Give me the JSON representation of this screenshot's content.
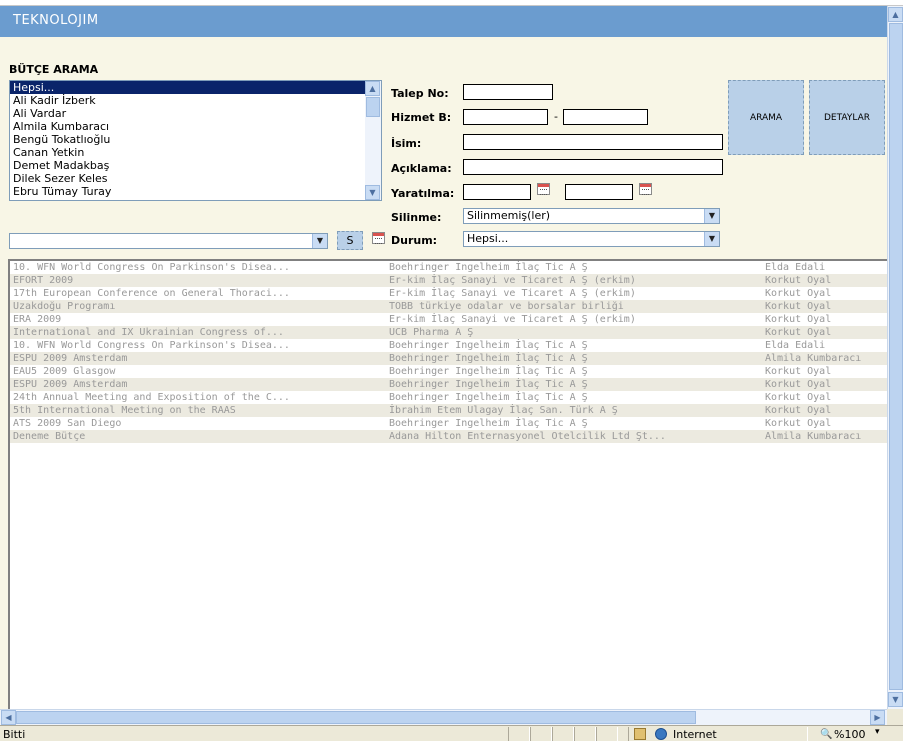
{
  "app": {
    "logo": "TEKNOLOJIM"
  },
  "search": {
    "title": "BÜTÇE ARAMA",
    "people": [
      "Hepsi...",
      "Ali Kadir İzberk",
      "Ali Vardar",
      "Almila Kumbaracı",
      "Bengü Tokatlıoğlu",
      "Canan Yetkin",
      "Demet Madakbaş",
      "Dilek Sezer Keles",
      "Ebru Tümay Turay"
    ],
    "selected_person_index": 0,
    "s_button": "S",
    "labels": {
      "talep_no": "Talep No:",
      "hizmet_b": "Hizmet B:",
      "dash": "-",
      "isim": "İsim:",
      "aciklama": "Açıklama:",
      "yaratilma": "Yaratılma:",
      "silinme": "Silinme:",
      "durum": "Durum:"
    },
    "silinme_value": "Silinmemiş(ler)",
    "durum_value": "Hepsi...",
    "arama_button": "ARAMA",
    "detaylar_button": "DETAYLAR"
  },
  "results": [
    [
      "10. WFN World Congress On Parkinson's Disea...",
      "Boehringer Ingelheim İlaç Tic A Ş",
      "Elda Edali"
    ],
    [
      "EFORT 2009",
      "Er-kim İlaç Sanayi ve Ticaret A Ş (erkim)",
      "Korkut Oyal"
    ],
    [
      "17th European Conference on General Thoraci...",
      "Er-kim İlaç Sanayi ve Ticaret A Ş (erkim)",
      "Korkut Oyal"
    ],
    [
      "Uzakdoğu Programı",
      "TOBB türkiye odalar ve borsalar birliği",
      "Korkut Oyal"
    ],
    [
      "ERA 2009",
      "Er-kim İlaç Sanayi ve Ticaret A Ş (erkim)",
      "Korkut Oyal"
    ],
    [
      "International and IX Ukrainian Congress of...",
      "UCB Pharma A Ş",
      "Korkut Oyal"
    ],
    [
      "10. WFN World Congress On Parkinson's Disea...",
      "Boehringer Ingelheim İlaç Tic A Ş",
      "Elda Edali"
    ],
    [
      "ESPU 2009 Amsterdam",
      "Boehringer Ingelheim İlaç Tic A Ş",
      "Almila Kumbaracı"
    ],
    [
      "EAU5 2009 Glasgow",
      "Boehringer Ingelheim İlaç Tic A Ş",
      "Korkut Oyal"
    ],
    [
      "ESPU 2009 Amsterdam",
      "Boehringer Ingelheim İlaç Tic A Ş",
      "Korkut Oyal"
    ],
    [
      "24th Annual Meeting and Exposition of the C...",
      "Boehringer Ingelheim İlaç Tic A Ş",
      "Korkut Oyal"
    ],
    [
      "5th International Meeting on the RAAS",
      "İbrahim Etem Ulagay İlaç San. Türk A Ş",
      "Korkut Oyal"
    ],
    [
      "ATS 2009 San Diego",
      "Boehringer Ingelheim İlaç Tic A Ş",
      "Korkut Oyal"
    ],
    [
      "Deneme Bütçe",
      "Adana Hilton Enternasyonel Otelcilik Ltd Şt...",
      "Almila Kumbaracı"
    ]
  ],
  "status": {
    "left": "Bitti",
    "zone": "Internet",
    "zoom": "%100"
  }
}
